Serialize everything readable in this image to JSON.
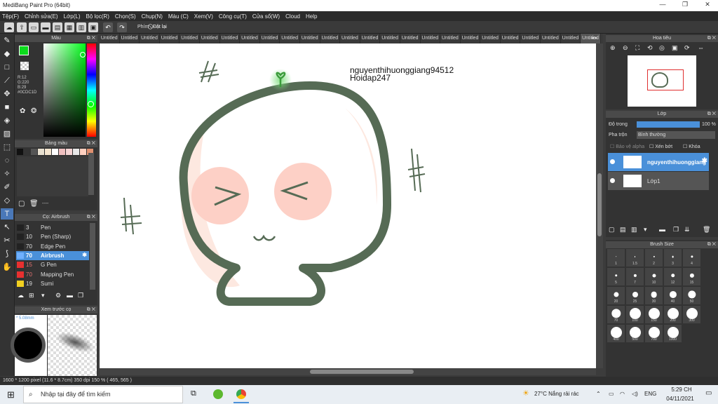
{
  "window": {
    "title": "MediBang Paint Pro (64bit)"
  },
  "menu": [
    "Tệp(F)",
    "Chỉnh sửa(E)",
    "Lớp(L)",
    "Bộ lọc(R)",
    "Chọn(S)",
    "Chụp(N)",
    "Màu (C)",
    "Xem(V)",
    "Công cụ(T)",
    "Cửa sổ(W)",
    "Cloud",
    "Help"
  ],
  "toolbar": {
    "key_label": "Phím",
    "reset_label": "Đặt lại"
  },
  "color_panel": {
    "title": "Màu",
    "r": "R:12",
    "g": "G:220",
    "b": "B:29",
    "hex": "#0CDC1D",
    "primary_color": "#0cdc1d"
  },
  "palette_panel": {
    "title": "Bảng màu",
    "colors": [
      "#111111",
      "#333333",
      "#555555",
      "#e8e0d0",
      "#f5e6d0",
      "#ffffff",
      "#f0c0c0",
      "#f5d5d5",
      "#e8e8e8",
      "#ffd0c0",
      "#e09070"
    ],
    "page": "----"
  },
  "brush_panel": {
    "title": "Cọ: Airbrush",
    "items": [
      {
        "size": "3",
        "name": "Pen",
        "color": "#222222"
      },
      {
        "size": "10",
        "name": "Pen (Sharp)",
        "color": "#222222"
      },
      {
        "size": "70",
        "name": "Edge Pen",
        "color": "#222222"
      },
      {
        "size": "70",
        "name": "Airbrush",
        "color": "#6fb0ff"
      },
      {
        "size": "15",
        "name": "G Pen",
        "color": "#e83030"
      },
      {
        "size": "70",
        "name": "Mapping Pen",
        "color": "#e83030"
      },
      {
        "size": "19",
        "name": "Sumi",
        "color": "#f2d020"
      }
    ]
  },
  "preview_panel": {
    "title": "Xem trước cọ",
    "size": "* 5.08mm"
  },
  "tabs": [
    "Untitled",
    "Untitled",
    "Untitled",
    "Untitled",
    "Untitled",
    "Untitled",
    "Untitled",
    "Untitled",
    "Untitled",
    "Untitled",
    "Untitled",
    "Untitled",
    "Untitled",
    "Untitled",
    "Untitled",
    "Untitled",
    "Untitled",
    "Untitled",
    "Untitled",
    "Untitled",
    "Untitled",
    "Untitled",
    "Untitled",
    "Untitled",
    "Untitled"
  ],
  "canvas": {
    "text_line1": "nguyenthihuonggiang94512",
    "text_line2": "Hoidap247"
  },
  "status": {
    "text": "1600 * 1200 pixel   (11.6 * 8.7cm)   350 dpi   150 %   ( 465, 565 )"
  },
  "navigator": {
    "title": "Hoa tiêu"
  },
  "layer_panel": {
    "title": "Lớp",
    "opacity_label": "Độ trong",
    "opacity_value": "100 %",
    "blend_label": "Pha trộn",
    "blend_value": "Bình thường",
    "protect_alpha": "Bảo vệ alpha",
    "clip": "Xén bớt",
    "lock": "Khóa",
    "layers": [
      {
        "name": "nguyenthihuonggiang"
      },
      {
        "name": "Lớp1"
      }
    ]
  },
  "brush_size": {
    "title": "Brush Size",
    "sizes": [
      "1",
      "1.5",
      "2",
      "3",
      "4",
      "5",
      "7",
      "10",
      "12",
      "15",
      "20",
      "25",
      "30",
      "40",
      "50",
      "70",
      "100",
      "150",
      "200",
      "300",
      "400",
      "500",
      "700",
      "1000"
    ]
  },
  "taskbar": {
    "search_placeholder": "Nhập tại đây để tìm kiếm",
    "weather": "27°C  Nắng rải rác",
    "lang": "ENG",
    "time": "5:29 CH",
    "date": "04/11/2021"
  }
}
